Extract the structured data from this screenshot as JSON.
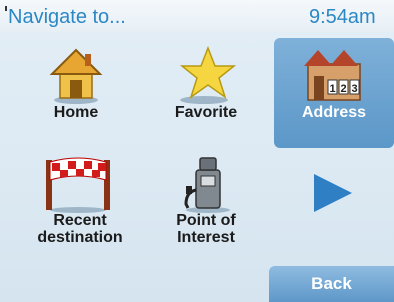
{
  "header": {
    "title": "Navigate to...",
    "clock": "9:54am"
  },
  "menu": {
    "items": [
      {
        "label": "Home",
        "icon": "house-icon"
      },
      {
        "label": "Favorite",
        "icon": "star-icon"
      },
      {
        "label": "Address",
        "icon": "address-building-icon",
        "selected": true
      },
      {
        "label_line1": "Recent",
        "label_line2": "destination",
        "icon": "finish-flag-icon"
      },
      {
        "label_line1": "Point of",
        "label_line2": "Interest",
        "icon": "fuel-pump-icon"
      }
    ],
    "address_numbers": [
      "1",
      "2",
      "3"
    ],
    "next_icon": "play-arrow-icon"
  },
  "footer": {
    "back_label": "Back"
  },
  "colors": {
    "accent": "#2b88c4",
    "selected": "#6ea6d2",
    "arrow": "#2f7fc4"
  }
}
